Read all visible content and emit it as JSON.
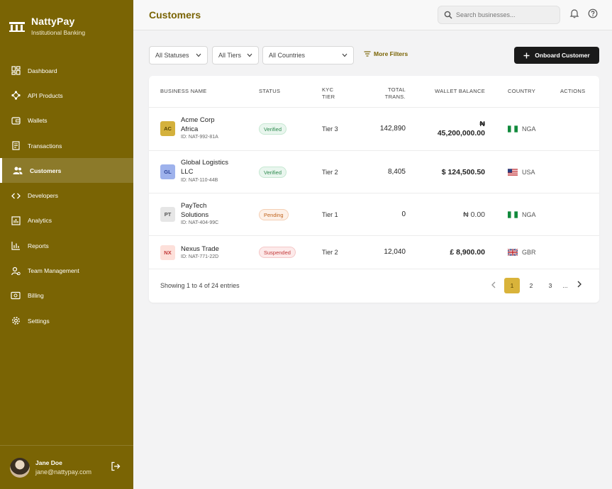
{
  "brand": {
    "name": "NattyPay",
    "subtitle": "Institutional Banking"
  },
  "nav": [
    {
      "label": "Dashboard",
      "icon": "dashboard-icon"
    },
    {
      "label": "API Products",
      "icon": "api-icon"
    },
    {
      "label": "Wallets",
      "icon": "wallet-icon"
    },
    {
      "label": "Transactions",
      "icon": "receipt-icon"
    },
    {
      "label": "Customers",
      "icon": "users-icon",
      "active": true
    },
    {
      "label": "Developers",
      "icon": "code-icon"
    },
    {
      "label": "Analytics",
      "icon": "chart-icon"
    },
    {
      "label": "Reports",
      "icon": "report-icon"
    },
    {
      "label": "Team Management",
      "icon": "team-icon"
    },
    {
      "label": "Billing",
      "icon": "billing-icon"
    },
    {
      "label": "Settings",
      "icon": "gear-icon"
    }
  ],
  "user": {
    "name": "Jane Doe",
    "email": "jane@nattypay.com"
  },
  "header": {
    "title": "Customers",
    "search_placeholder": "Search businesses..."
  },
  "filters": {
    "status": "All Statuses",
    "tier": "All Tiers",
    "country": "All Countries",
    "more": "More Filters"
  },
  "onboard_label": "Onboard Customer",
  "table": {
    "headers": {
      "business": "BUSINESS NAME",
      "status": "STATUS",
      "kyc_1": "KYC",
      "kyc_2": "TIER",
      "trans_1": "TOTAL",
      "trans_2": "TRANS.",
      "balance": "WALLET BALANCE",
      "country": "COUNTRY",
      "actions": "ACTIONS"
    },
    "rows": [
      {
        "initials": "AC",
        "name_1": "Acme Corp",
        "name_2": "Africa",
        "id": "ID: NAT-992-81A",
        "status": "Verified",
        "kyc": "Tier 3",
        "trans": "142,890",
        "bal_1": "₦",
        "bal_2": "45,200,000.00",
        "country": "NGA"
      },
      {
        "initials": "GL",
        "name_1": "Global Logistics",
        "name_2": "LLC",
        "id": "ID: NAT-110-44B",
        "status": "Verified",
        "kyc": "Tier 2",
        "trans": "8,405",
        "bal_1": "",
        "bal_2": "$ 124,500.50",
        "country": "USA"
      },
      {
        "initials": "PT",
        "name_1": "PayTech",
        "name_2": "Solutions",
        "id": "ID: NAT-404-99C",
        "status": "Pending",
        "kyc": "Tier 1",
        "trans": "0",
        "bal_1": "",
        "bal_2": "₦ 0.00",
        "country": "NGA"
      },
      {
        "initials": "NX",
        "name_1": "Nexus Trade",
        "name_2": "",
        "id": "ID: NAT-771-22D",
        "status": "Suspended",
        "kyc": "Tier 2",
        "trans": "12,040",
        "bal_1": "",
        "bal_2": "£ 8,900.00",
        "country": "GBR"
      }
    ]
  },
  "pagination": {
    "summary": "Showing 1 to 4 of 24 entries",
    "pages": [
      "1",
      "2",
      "3",
      "..."
    ]
  },
  "colors": {
    "sidebar": "#7a6404",
    "accent": "#d9b33a",
    "verified": "#2e8a4f",
    "pending": "#c0641d",
    "suspended": "#c23a3a"
  }
}
